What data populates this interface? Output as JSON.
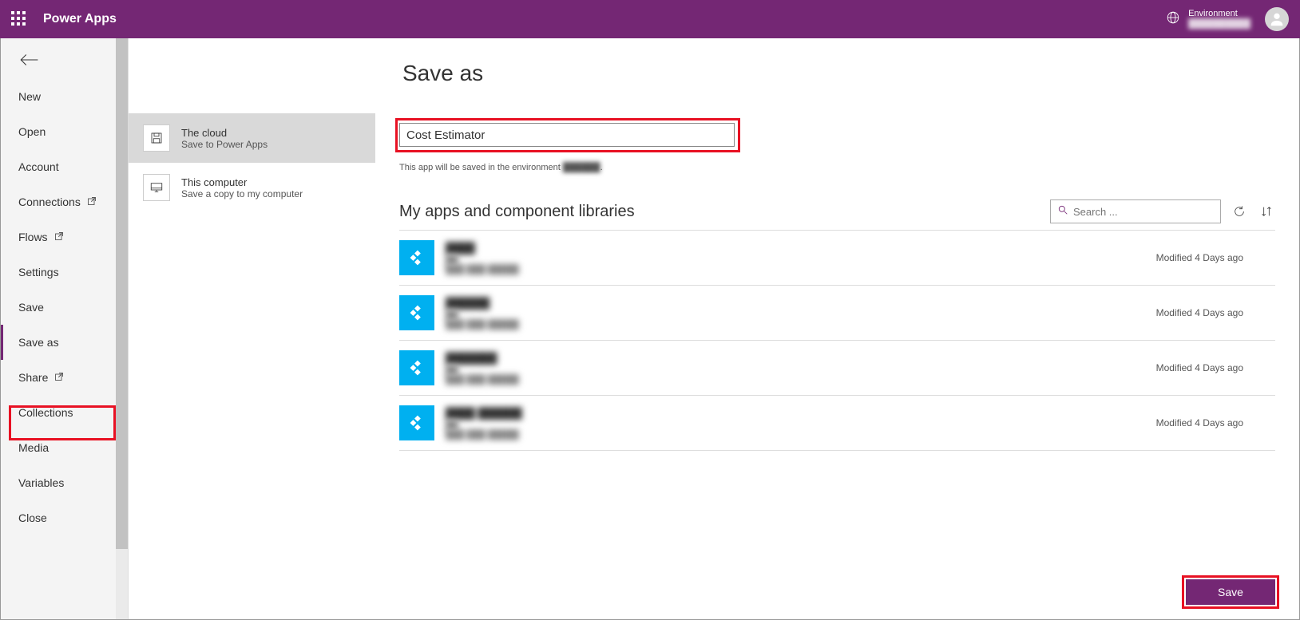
{
  "header": {
    "brand": "Power Apps",
    "environment_label": "Environment",
    "environment_name": "██████████"
  },
  "sidebar": {
    "items": [
      {
        "label": "New",
        "ext": false
      },
      {
        "label": "Open",
        "ext": false
      },
      {
        "label": "Account",
        "ext": false
      },
      {
        "label": "Connections",
        "ext": true
      },
      {
        "label": "Flows",
        "ext": true
      },
      {
        "label": "Settings",
        "ext": false
      },
      {
        "label": "Save",
        "ext": false
      },
      {
        "label": "Save as",
        "ext": false,
        "selected": true
      },
      {
        "label": "Share",
        "ext": true
      },
      {
        "label": "Collections",
        "ext": false
      },
      {
        "label": "Media",
        "ext": false
      },
      {
        "label": "Variables",
        "ext": false
      },
      {
        "label": "Close",
        "ext": false
      }
    ]
  },
  "page": {
    "title": "Save as"
  },
  "save_targets": [
    {
      "title": "The cloud",
      "sub": "Save to Power Apps",
      "active": true,
      "icon": "save"
    },
    {
      "title": "This computer",
      "sub": "Save a copy to my computer",
      "active": false,
      "icon": "computer"
    }
  ],
  "name_input": {
    "value": "Cost Estimator"
  },
  "env_note": {
    "prefix": "This app will be saved in the environment ",
    "env": "██████",
    "suffix": "."
  },
  "apps_section": {
    "title": "My apps and component libraries",
    "search_placeholder": "Search ..."
  },
  "apps": [
    {
      "name": "████",
      "sub1": "██",
      "sub2": "███ ███ █████",
      "modified": "Modified 4 Days ago"
    },
    {
      "name": "██████",
      "sub1": "██",
      "sub2": "███ ███ █████",
      "modified": "Modified 4 Days ago"
    },
    {
      "name": "███████",
      "sub1": "██",
      "sub2": "███ ███ █████",
      "modified": "Modified 4 Days ago"
    },
    {
      "name": "████ ██████",
      "sub1": "██",
      "sub2": "███ ███ █████",
      "modified": "Modified 4 Days ago"
    }
  ],
  "buttons": {
    "save": "Save"
  }
}
